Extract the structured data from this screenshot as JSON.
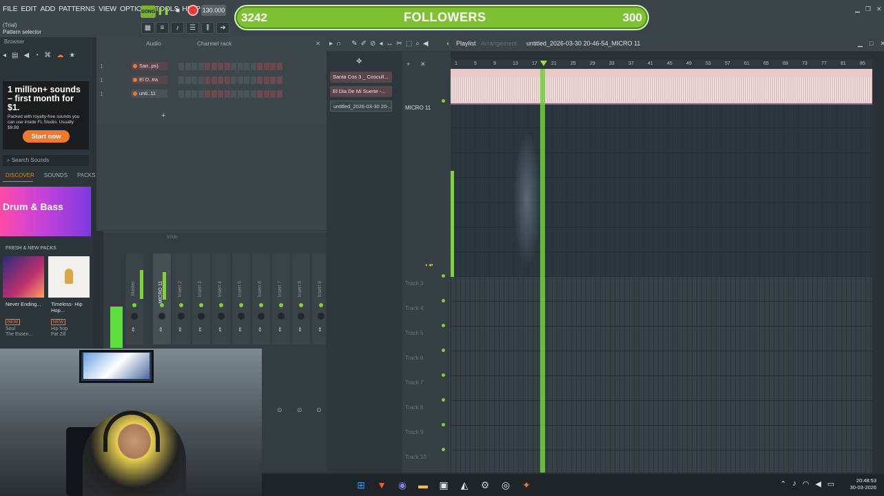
{
  "menu": [
    "FILE",
    "EDIT",
    "ADD",
    "PATTERNS",
    "VIEW",
    "OPTIONS",
    "TOOLS",
    "HELP"
  ],
  "hint": {
    "line1": "(Trial)",
    "line2": "Pattern selector"
  },
  "transport": {
    "song": "SONG",
    "tempo": "130.000"
  },
  "followers": {
    "current": "3242",
    "label": "FOLLOWERS",
    "goal": "300"
  },
  "browser": {
    "title": "Browser",
    "ad": {
      "title": "1 million+ sounds – first month for $1.",
      "body": "Packed with royalty-free sounds you can use inside FL Studio. Usually $9.99",
      "cta": "Start now"
    },
    "search_placeholder": "Search Sounds",
    "tabs": [
      "DISCOVER",
      "SOUNDS",
      "PACKS"
    ],
    "banner": "Drum & Bass",
    "section": "FRESH & NEW PACKS",
    "packs": [
      {
        "title": "Never Ending...",
        "badge": "NEW",
        "genre": "Soul",
        "author": "The Essen..."
      },
      {
        "title": "Timeless- Hip Hop...",
        "badge": "NEW",
        "genre": "Hip hop",
        "author": "Pat Zill"
      }
    ]
  },
  "channel_rack": {
    "title": "Channel rack",
    "filter": "Audio",
    "channels": [
      {
        "num": "1",
        "name": "San..ps)"
      },
      {
        "num": "1",
        "name": "El D..tra"
      },
      {
        "num": "1",
        "name": "unti..11"
      }
    ]
  },
  "mixer": {
    "mode": "Wide",
    "tracks": [
      "Master",
      "MICRO 11",
      "Insert 2",
      "Insert 3",
      "Insert 4",
      "Insert 5",
      "Insert 6",
      "Insert 7",
      "Insert 8",
      "Insert 9"
    ]
  },
  "playlist": {
    "title": "Playlist",
    "arrangement": "Arrangement",
    "file": "untitled_2026-03-30 20-46-54_MICRO 11",
    "patterns": [
      "Santa Cos 3 _ Coscull...",
      "El Dia De Mi Suerte -...",
      "untitled_2026-03-30 20-..."
    ],
    "tracks": [
      "MICRO 11",
      "Track 3",
      "Track 4",
      "Track 5",
      "Track 6",
      "Track 7",
      "Track 8",
      "Track 9",
      "Track 10"
    ],
    "ruler": [
      "1",
      "5",
      "9",
      "13",
      "17",
      "21",
      "25",
      "29",
      "33",
      "37",
      "41",
      "45",
      "49",
      "53",
      "57",
      "61",
      "65",
      "69",
      "73",
      "77",
      "81",
      "85"
    ]
  },
  "taskbar": {
    "time": "20:48:53",
    "date": "30-03-2026"
  }
}
